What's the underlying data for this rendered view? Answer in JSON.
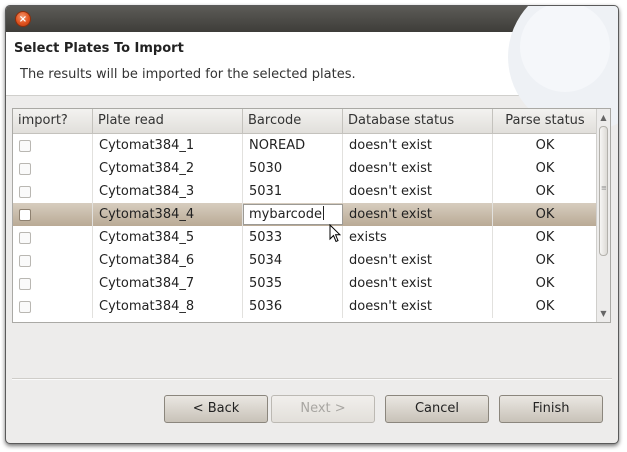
{
  "window": {
    "close_glyph": "×"
  },
  "header": {
    "title": "Select Plates To Import",
    "description": "The results will be imported for the selected plates."
  },
  "table": {
    "columns": [
      "import?",
      "Plate read",
      "Barcode",
      "Database status",
      "Parse status"
    ],
    "rows": [
      {
        "checked": false,
        "plate": "Cytomat384_1",
        "barcode": "NOREAD",
        "db_status": "doesn't exist",
        "parse_status": "OK"
      },
      {
        "checked": false,
        "plate": "Cytomat384_2",
        "barcode": "5030",
        "db_status": "doesn't exist",
        "parse_status": "OK"
      },
      {
        "checked": false,
        "plate": "Cytomat384_3",
        "barcode": "5031",
        "db_status": "doesn't exist",
        "parse_status": "OK"
      },
      {
        "checked": false,
        "plate": "Cytomat384_4",
        "barcode": "mybarcode",
        "db_status": "doesn't exist",
        "parse_status": "OK",
        "selected": true,
        "editing": true
      },
      {
        "checked": false,
        "plate": "Cytomat384_5",
        "barcode": "5033",
        "db_status": "exists",
        "parse_status": "OK"
      },
      {
        "checked": false,
        "plate": "Cytomat384_6",
        "barcode": "5034",
        "db_status": "doesn't exist",
        "parse_status": "OK"
      },
      {
        "checked": false,
        "plate": "Cytomat384_7",
        "barcode": "5035",
        "db_status": "doesn't exist",
        "parse_status": "OK"
      },
      {
        "checked": false,
        "plate": "Cytomat384_8",
        "barcode": "5036",
        "db_status": "doesn't exist",
        "parse_status": "OK"
      }
    ]
  },
  "scrollbar": {
    "up_glyph": "▲",
    "down_glyph": "▼"
  },
  "buttons": {
    "back": "< Back",
    "next": "Next >",
    "cancel": "Cancel",
    "finish": "Finish"
  },
  "colors": {
    "selected_row": "#c8bba8",
    "title_bar": "#4c4b47",
    "close_button": "#e0531f"
  }
}
